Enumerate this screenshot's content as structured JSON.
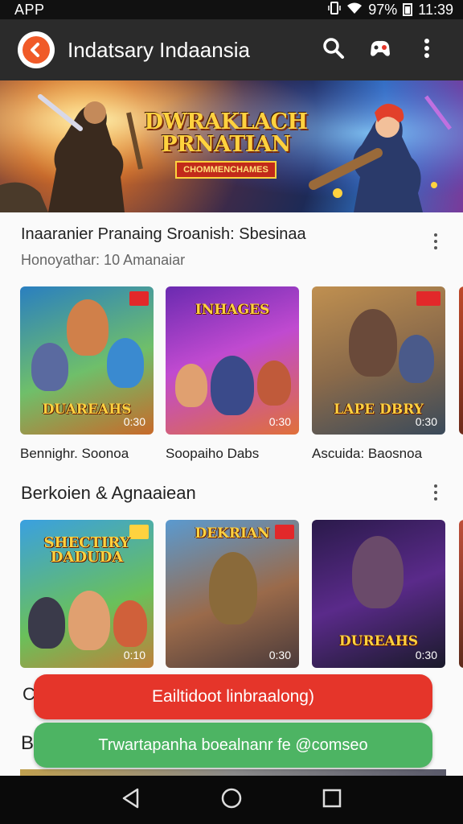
{
  "status_bar": {
    "carrier": "APP",
    "battery_pct": "97%",
    "time": "11:39"
  },
  "toolbar": {
    "title": "Indatsary Indaansia",
    "icons": [
      "search-icon",
      "gamepad-icon",
      "more-vert-icon"
    ]
  },
  "hero": {
    "title": "DWRAKLACH PRNATIAN",
    "subtitle": "CHOMMENCHAMES"
  },
  "section1": {
    "title": "Inaaranier Pranaing Sroanish: Sbesinaa",
    "subtitle": "Honoyathar: 10 Amanaiar",
    "cards": [
      {
        "logo": "DUAREAHS",
        "duration": "0:30",
        "label": "Bennighr. Soonoa"
      },
      {
        "logo": "INHAGES",
        "duration": "0:30",
        "label": "Soopaiho Dabs"
      },
      {
        "logo": "LAPE DBRY",
        "duration": "0:30",
        "label": "Ascuida: Baosnoa"
      }
    ]
  },
  "section2": {
    "title": "Berkoien & Agnaaiean",
    "cards": [
      {
        "logo": "SHECTIRY DADUDA",
        "duration": "0:10"
      },
      {
        "logo": "DEKRIAN",
        "duration": "0:30"
      },
      {
        "logo": "DUREAHS",
        "duration": "0:30"
      }
    ]
  },
  "buttons": {
    "primary_label": "Eailtidoot linbraalong)",
    "secondary_label": "Trwartapanha boealnanr fe @comseo"
  },
  "peek": {
    "row_char": "C",
    "section_char": "B"
  },
  "colors": {
    "accent_red": "#e5352a",
    "accent_green": "#4db463",
    "toolbar": "#2b2b2b"
  }
}
